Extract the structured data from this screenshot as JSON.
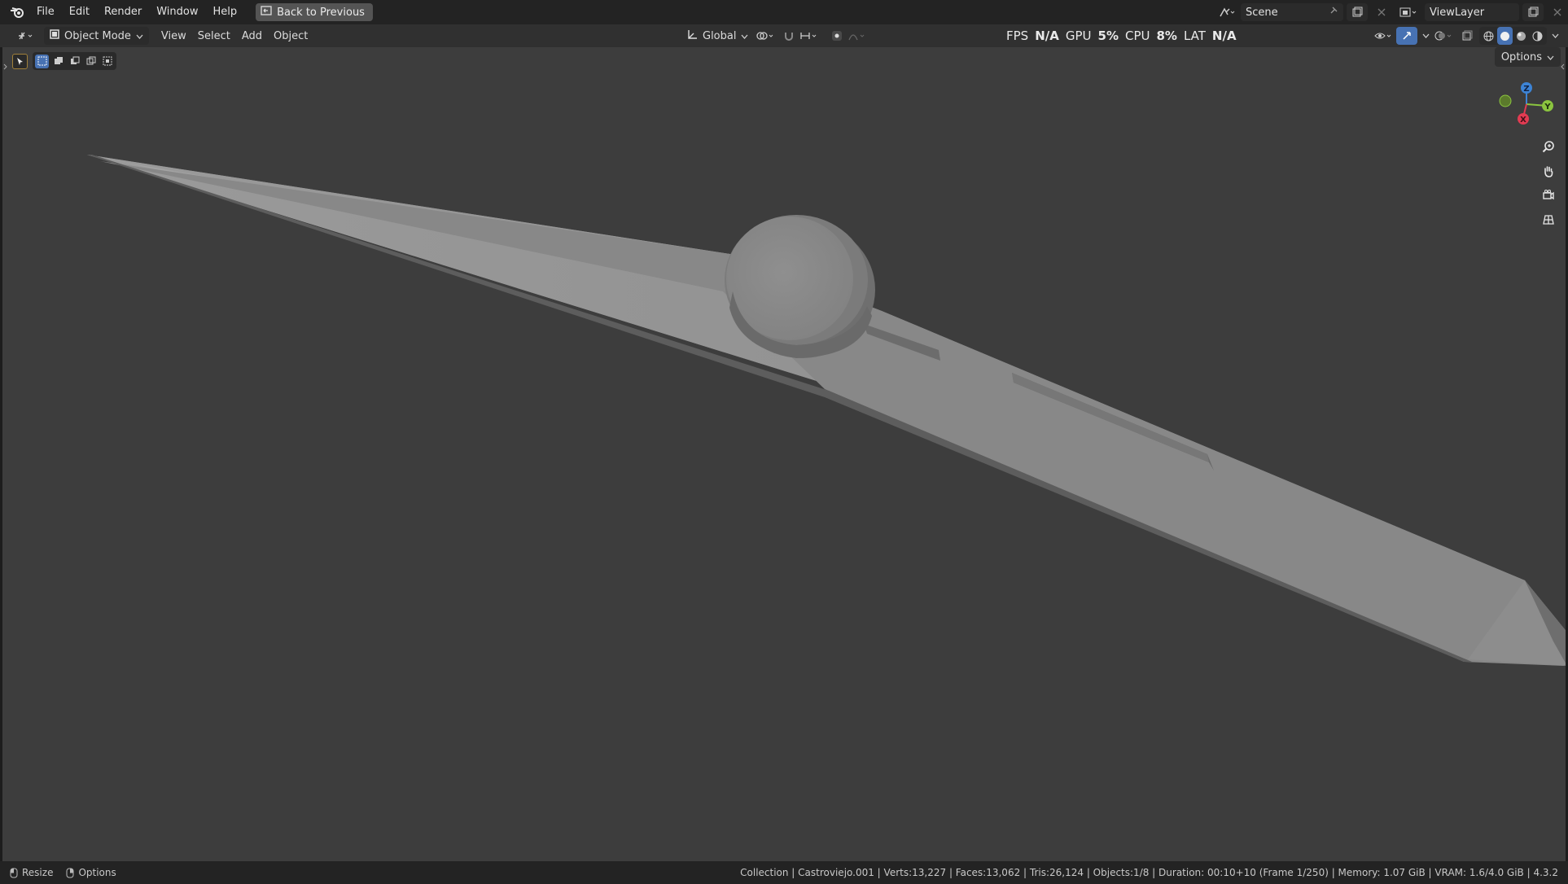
{
  "menubar": {
    "items": [
      "File",
      "Edit",
      "Render",
      "Window",
      "Help"
    ],
    "back_button": "Back to Previous",
    "scene": "Scene",
    "view_layer": "ViewLayer"
  },
  "header": {
    "mode": "Object Mode",
    "menus": [
      "View",
      "Select",
      "Add",
      "Object"
    ],
    "transform_orientation": "Global",
    "stats": {
      "fps_label": "FPS",
      "fps_value": "N/A",
      "gpu_label": "GPU",
      "gpu_value": "5%",
      "cpu_label": "CPU",
      "cpu_value": "8%",
      "lat_label": "LAT",
      "lat_value": "N/A"
    }
  },
  "viewport": {
    "options_label": "Options",
    "gizmo": {
      "z": "Z",
      "y": "Y",
      "x": "X"
    }
  },
  "statusbar": {
    "left": [
      "Resize",
      "Options"
    ],
    "info": "Collection | Castroviejo.001 | Verts:13,227 | Faces:13,062 | Tris:26,124 | Objects:1/8 | Duration: 00:10+10 (Frame 1/250) | Memory: 1.07 GiB | VRAM: 1.6/4.0 GiB | 4.3.2"
  },
  "colors": {
    "axis_x": "#e23b52",
    "axis_y": "#8bc53f",
    "axis_z": "#3d84d6",
    "object": "#8e8e8e",
    "viewport_bg": "#3d3d3d"
  }
}
